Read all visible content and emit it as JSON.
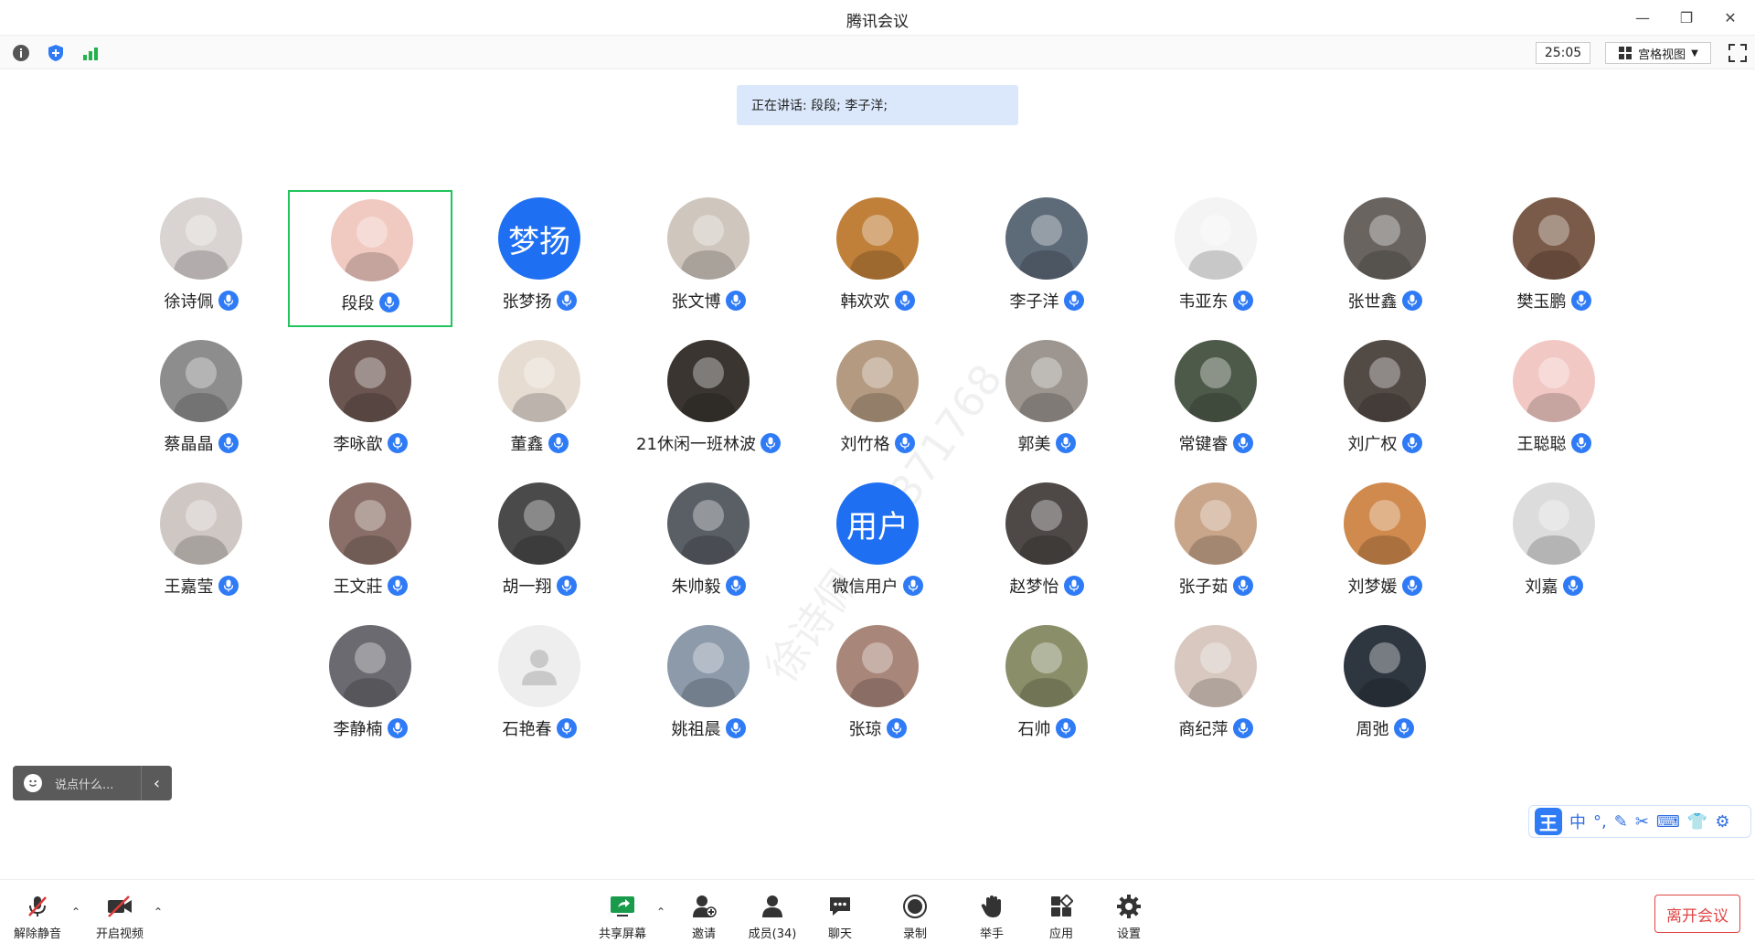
{
  "window": {
    "title": "腾讯会议"
  },
  "toolbar": {
    "timer": "25:05",
    "view_label": "宫格视图"
  },
  "speaking": {
    "text": "正在讲话: 段段; 李子洋;"
  },
  "participants": [
    {
      "name": "徐诗佩",
      "color": "#d9d4d2"
    },
    {
      "name": "段段",
      "color": "#f0c9c0",
      "active": true
    },
    {
      "name": "张梦扬",
      "color": "#1f6ff2",
      "initials": "梦扬"
    },
    {
      "name": "张文博",
      "color": "#cfc6bd"
    },
    {
      "name": "韩欢欢",
      "color": "#c0803a"
    },
    {
      "name": "李子洋",
      "color": "#5d6a78"
    },
    {
      "name": "韦亚东",
      "color": "#f4f4f4"
    },
    {
      "name": "张世鑫",
      "color": "#6a6460"
    },
    {
      "name": "樊玉鹏",
      "color": "#7a5a48"
    },
    {
      "name": "蔡晶晶",
      "color": "#8d8d8d"
    },
    {
      "name": "李咏歆",
      "color": "#6b5550"
    },
    {
      "name": "董鑫",
      "color": "#e6dcd2"
    },
    {
      "name": "21休闲一班林波",
      "color": "#3a3530"
    },
    {
      "name": "刘竹格",
      "color": "#b49a80"
    },
    {
      "name": "郭美",
      "color": "#9c9590"
    },
    {
      "name": "常键睿",
      "color": "#4d5a4a"
    },
    {
      "name": "刘广权",
      "color": "#524a45"
    },
    {
      "name": "王聪聪",
      "color": "#f2c8c4"
    },
    {
      "name": "王嘉莹",
      "color": "#cfc7c4"
    },
    {
      "name": "王文莊",
      "color": "#8a6f68"
    },
    {
      "name": "胡一翔",
      "color": "#4a4a4a"
    },
    {
      "name": "朱帅毅",
      "color": "#5a5f66"
    },
    {
      "name": "微信用户",
      "color": "#1f6ff2",
      "initials": "用户"
    },
    {
      "name": "赵梦怡",
      "color": "#4e4846"
    },
    {
      "name": "张子茹",
      "color": "#c9a58a"
    },
    {
      "name": "刘梦媛",
      "color": "#d08a4e"
    },
    {
      "name": "刘嘉",
      "color": "#dcdcdc"
    },
    {
      "name": "李静楠",
      "color": "#6a6a70"
    },
    {
      "name": "石艳春",
      "color": "#eeeeee",
      "placeholder": true
    },
    {
      "name": "姚祖晨",
      "color": "#8c9aaa"
    },
    {
      "name": "张琼",
      "color": "#a9867a"
    },
    {
      "name": "石帅",
      "color": "#8a8f6a"
    },
    {
      "name": "商纪萍",
      "color": "#d8c8c0"
    },
    {
      "name": "周弛",
      "color": "#2e3640"
    }
  ],
  "chat": {
    "placeholder": "说点什么..."
  },
  "ime": {
    "brand": "王",
    "mode": "中"
  },
  "bottombar": {
    "unmute": "解除静音",
    "start_video": "开启视频",
    "share_screen": "共享屏幕",
    "invite": "邀请",
    "members": "成员(34)",
    "chat": "聊天",
    "record": "录制",
    "raise_hand": "举手",
    "apps": "应用",
    "settings": "设置",
    "leave": "离开会议"
  },
  "watermark": "徐诗佩 + 3371768"
}
